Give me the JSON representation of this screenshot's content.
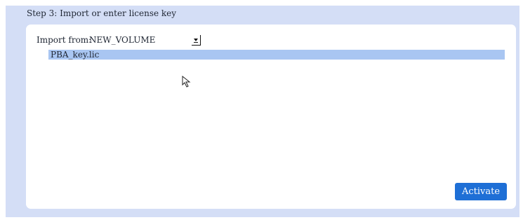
{
  "step": {
    "title": "Step 3: Import or enter license key"
  },
  "import": {
    "label": "Import from:",
    "selected_source": "NEW_VOLUME",
    "dropdown_icon": "triangle-down-icon"
  },
  "files": [
    {
      "name": "PBA_key.lic",
      "selected": true
    }
  ],
  "actions": {
    "activate_label": "Activate"
  },
  "colors": {
    "frame_bg": "#d4def6",
    "panel_bg": "#ffffff",
    "selection": "#a9c6f2",
    "accent": "#1e6fd6"
  },
  "cursor": {
    "icon": "mouse-pointer-icon"
  }
}
